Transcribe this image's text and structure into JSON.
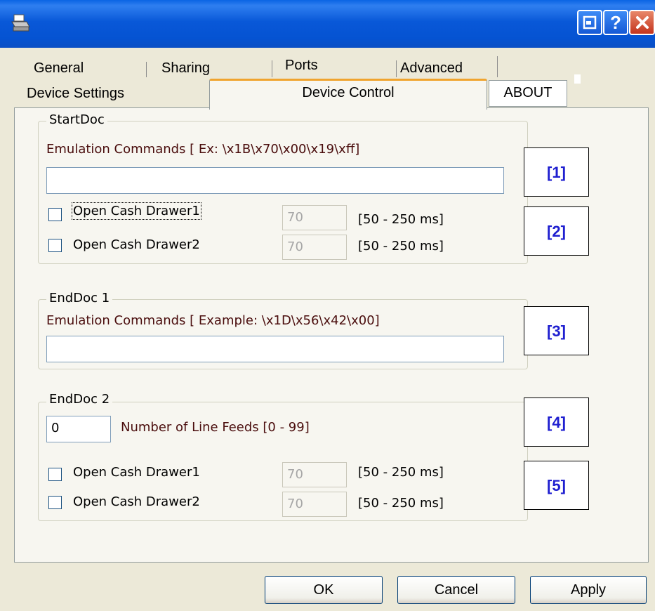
{
  "window": {
    "icons": {
      "app": "printer-icon",
      "minimize": "minimize-icon",
      "help": "help-icon",
      "close": "close-icon"
    },
    "help_label": "?"
  },
  "tabs_row1": [
    "General",
    "Sharing",
    "Ports",
    "Advanced"
  ],
  "tabs_row2": {
    "device_settings": "Device Settings",
    "device_control": "Device Control",
    "about": "ABOUT"
  },
  "startdoc": {
    "legend": "StartDoc",
    "emulation_label": "Emulation Commands [ Ex: \\x1B\\x70\\x00\\x19\\xff]",
    "emulation_value": "",
    "drawer1": {
      "label": "Open Cash Drawer1",
      "value": "70",
      "range": "[50 - 250 ms]",
      "checked": false
    },
    "drawer2": {
      "label": "Open Cash Drawer2",
      "value": "70",
      "range": "[50 - 250 ms]",
      "checked": false
    }
  },
  "enddoc1": {
    "legend": "EndDoc 1",
    "emulation_label": "Emulation Commands [ Example: \\x1D\\x56\\x42\\x00]",
    "emulation_value": ""
  },
  "enddoc2": {
    "legend": "EndDoc 2",
    "line_feeds_value": "0",
    "line_feeds_label": "Number of Line Feeds [0 - 99]",
    "drawer1": {
      "label": "Open Cash Drawer1",
      "value": "70",
      "range": "[50 - 250 ms]",
      "checked": false
    },
    "drawer2": {
      "label": "Open Cash Drawer2",
      "value": "70",
      "range": "[50 - 250 ms]",
      "checked": false
    }
  },
  "markers": [
    "[1]",
    "[2]",
    "[3]",
    "[4]",
    "[5]"
  ],
  "buttons": {
    "ok": "OK",
    "cancel": "Cancel",
    "apply": "Apply"
  },
  "colors": {
    "titlebar": "#0a58d8",
    "active_tab_accent": "#f0a42e",
    "marker_text": "#1f1fd0",
    "label_text": "#4a0d0d"
  }
}
